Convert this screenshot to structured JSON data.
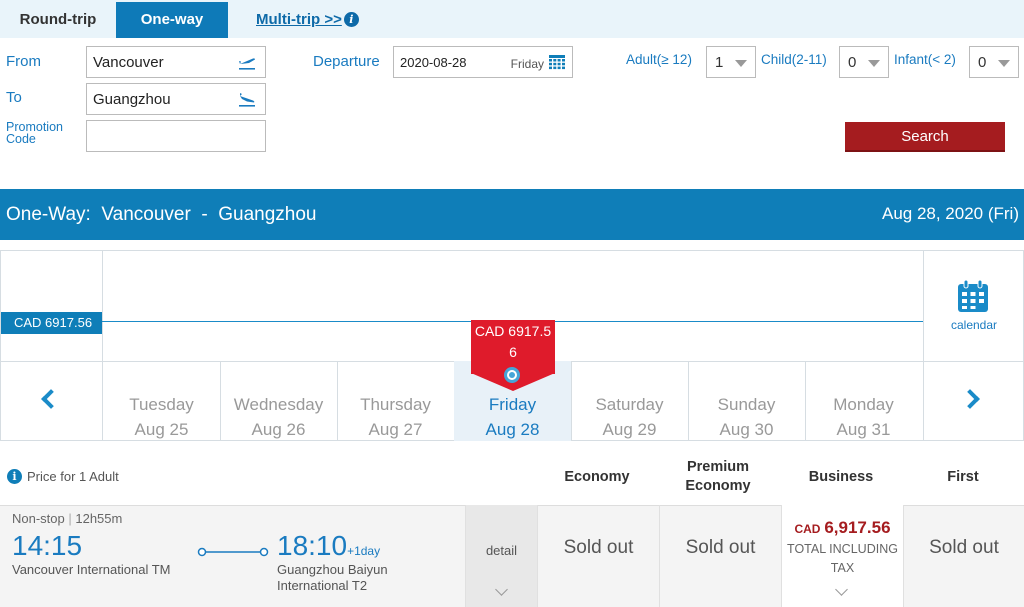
{
  "trip_tabs": {
    "round_trip": "Round-trip",
    "one_way": "One-way",
    "multi_trip": "Multi-trip >>"
  },
  "form": {
    "from_label": "From",
    "from_value": "Vancouver",
    "to_label": "To",
    "to_value": "Guangzhou",
    "promo_label_line1": "Promotion",
    "promo_label_line2": "Code",
    "promo_value": "",
    "departure_label": "Departure",
    "departure_value": "2020-08-28",
    "departure_day": "Friday",
    "adult_label": "Adult(≥ 12)",
    "adult_value": "1",
    "child_label": "Child(2-11)",
    "child_value": "0",
    "infant_label": "Infant(< 2)",
    "infant_value": "0",
    "search_label": "Search"
  },
  "route_bar": {
    "title": "One-Way:  Vancouver  -  Guangzhou",
    "date": "Aug 28, 2020 (Fri)"
  },
  "price_graph": {
    "price_label": "CAD 6917.56",
    "selected_bubble_line1": "CAD 6917.5",
    "selected_bubble_line2": "6",
    "calendar_label": "calendar",
    "days": [
      {
        "weekday": "Tuesday",
        "date": "Aug 25",
        "selected": false
      },
      {
        "weekday": "Wednesday",
        "date": "Aug 26",
        "selected": false
      },
      {
        "weekday": "Thursday",
        "date": "Aug 27",
        "selected": false
      },
      {
        "weekday": "Friday",
        "date": "Aug 28",
        "selected": true
      },
      {
        "weekday": "Saturday",
        "date": "Aug 29",
        "selected": false
      },
      {
        "weekday": "Sunday",
        "date": "Aug 30",
        "selected": false
      },
      {
        "weekday": "Monday",
        "date": "Aug 31",
        "selected": false
      }
    ]
  },
  "results": {
    "price_for": "Price for 1 Adult",
    "columns": {
      "economy": "Economy",
      "premium_line1": "Premium",
      "premium_line2": "Economy",
      "business": "Business",
      "first": "First"
    },
    "flight": {
      "stops": "Non-stop",
      "duration": "12h55m",
      "depart_time": "14:15",
      "depart_airport": "Vancouver International TM",
      "arrive_time": "18:10",
      "arrive_suffix": "+1day",
      "arrive_airport_line1": "Guangzhou Baiyun",
      "arrive_airport_line2": "International T2",
      "detail_label": "detail",
      "economy": "Sold out",
      "premium_economy": "Sold out",
      "business_currency": "CAD",
      "business_price": "6,917.56",
      "business_note_line1": "TOTAL INCLUDING",
      "business_note_line2": "TAX",
      "first": "Sold out"
    }
  },
  "colors": {
    "primary_blue": "#0f7eb8",
    "search_red": "#a51c1f",
    "selected_bubble": "#df1b2b",
    "price_red": "#a51c1f"
  }
}
